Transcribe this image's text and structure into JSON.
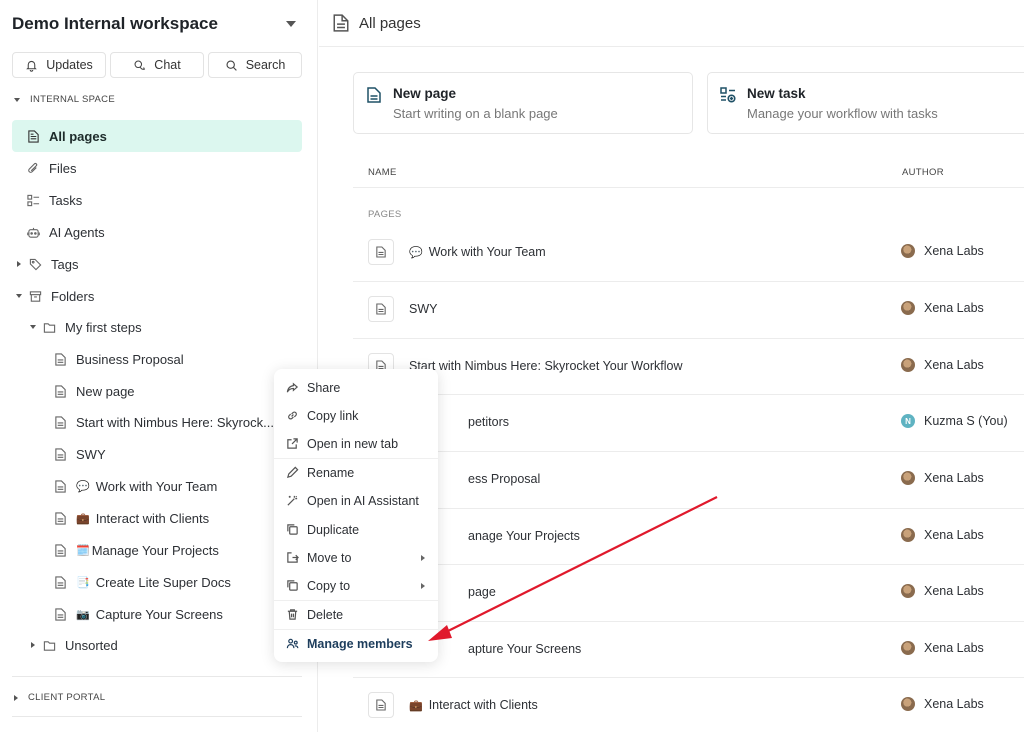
{
  "sidebar": {
    "workspace_title": "Demo Internal workspace",
    "top_buttons": {
      "updates": "Updates",
      "chat": "Chat",
      "search": "Search"
    },
    "section_internal": "INTERNAL SPACE",
    "nav": {
      "all_pages": "All pages",
      "files": "Files",
      "tasks": "Tasks",
      "ai_agents": "AI Agents",
      "tags": "Tags",
      "folders": "Folders"
    },
    "folder_name": "My first steps",
    "folder_pages": [
      {
        "emoji": "",
        "title": "Business Proposal"
      },
      {
        "emoji": "",
        "title": "New page"
      },
      {
        "emoji": "",
        "title": "Start with Nimbus Here: Skyrock..."
      },
      {
        "emoji": "",
        "title": "SWY"
      },
      {
        "emoji": "💬",
        "title": "Work with Your Team"
      },
      {
        "emoji": "💼",
        "title": "Interact with Clients"
      },
      {
        "emoji": "🗓️",
        "title": "Manage Your Projects"
      },
      {
        "emoji": "📑",
        "title": "Create Lite Super Docs"
      },
      {
        "emoji": "📷",
        "title": "Capture Your Screens"
      }
    ],
    "unsorted": "Unsorted",
    "section_client": "CLIENT PORTAL"
  },
  "main": {
    "header_title": "All pages",
    "cards": {
      "new_page": {
        "title": "New page",
        "subtitle": "Start writing on a blank page"
      },
      "new_task": {
        "title": "New task",
        "subtitle": "Manage your workflow with tasks"
      }
    },
    "columns": {
      "name": "NAME",
      "author": "AUTHOR"
    },
    "group_label": "PAGES",
    "rows": [
      {
        "emoji": "💬",
        "title": "Work with Your Team",
        "author": "Xena Labs"
      },
      {
        "emoji": "",
        "title": "SWY",
        "author": "Xena Labs"
      },
      {
        "emoji": "",
        "title": "Start with Nimbus Here: Skyrocket Your Workflow",
        "author": "Xena Labs"
      },
      {
        "emoji": "",
        "title": "petitors",
        "author": "Kuzma S (You)"
      },
      {
        "emoji": "",
        "title": "ess Proposal",
        "author": "Xena Labs"
      },
      {
        "emoji": "",
        "title": "anage Your Projects",
        "author": "Xena Labs"
      },
      {
        "emoji": "",
        "title": "page",
        "author": "Xena Labs"
      },
      {
        "emoji": "",
        "title": "apture Your Screens",
        "author": "Xena Labs"
      },
      {
        "emoji": "💼",
        "title": "Interact with Clients",
        "author": "Xena Labs"
      }
    ],
    "kuzma_initial": "N"
  },
  "context_menu": {
    "share": "Share",
    "copy_link": "Copy link",
    "open_new_tab": "Open in new tab",
    "rename": "Rename",
    "open_ai": "Open in AI Assistant",
    "duplicate": "Duplicate",
    "move_to": "Move to",
    "copy_to": "Copy to",
    "delete": "Delete",
    "manage_members": "Manage members"
  },
  "colors": {
    "active_bg": "#dcf7ef",
    "accent_text": "#1d3d5c",
    "arrow": "#e0192c"
  }
}
